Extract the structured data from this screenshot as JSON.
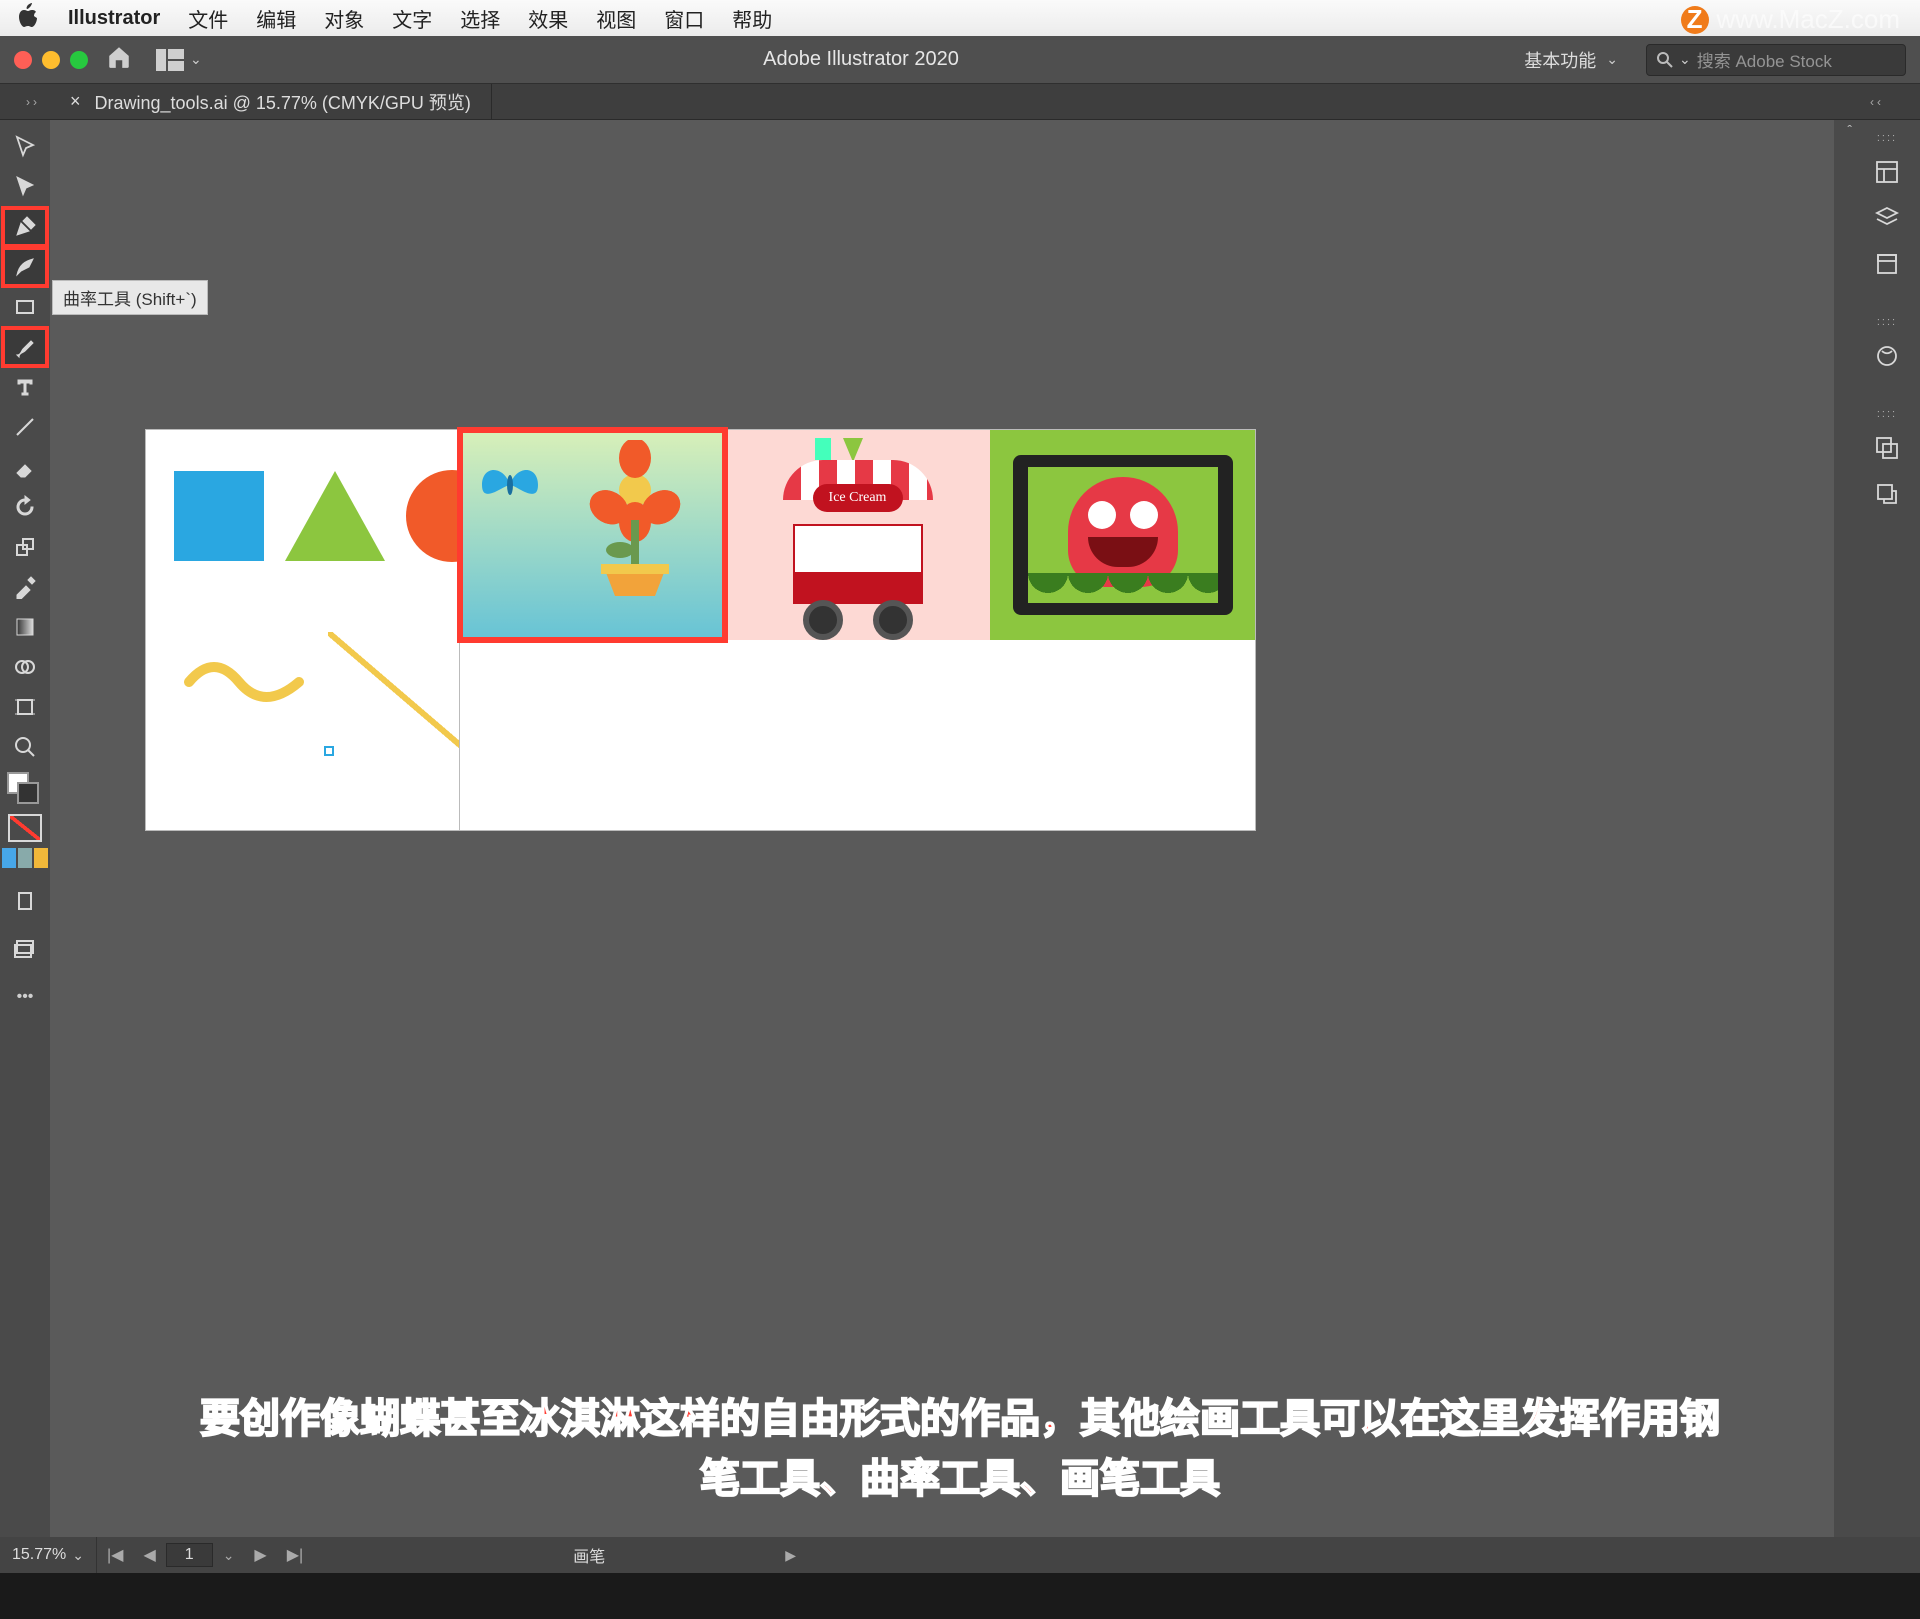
{
  "menubar": {
    "app_name": "Illustrator",
    "items": [
      "文件",
      "编辑",
      "对象",
      "文字",
      "选择",
      "效果",
      "视图",
      "窗口",
      "帮助"
    ]
  },
  "watermark": {
    "text": "www.MacZ.com",
    "badge": "Z"
  },
  "chrome": {
    "title": "Adobe Illustrator 2020",
    "workspace": "基本功能",
    "search_placeholder": "搜索 Adobe Stock"
  },
  "doc_tab": {
    "name": "Drawing_tools.ai @ 15.77% (CMYK/GPU 预览)"
  },
  "tooltip": {
    "text": "曲率工具 (Shift+`)"
  },
  "icecream_sign": "Ice Cream",
  "caption": {
    "line1": "要创作像蝴蝶甚至冰淇淋这样的自由形式的作品，其他绘画工具可以在这里发挥作用钢",
    "line2": "笔工具、曲率工具、画笔工具"
  },
  "status": {
    "zoom": "15.77%",
    "artboard_num": "1",
    "artboard_label": "画笔"
  },
  "colors": {
    "square": "#2aa7e1",
    "triangle": "#8cc63f",
    "circle": "#f15a29",
    "highlight": "#ff3b30"
  }
}
